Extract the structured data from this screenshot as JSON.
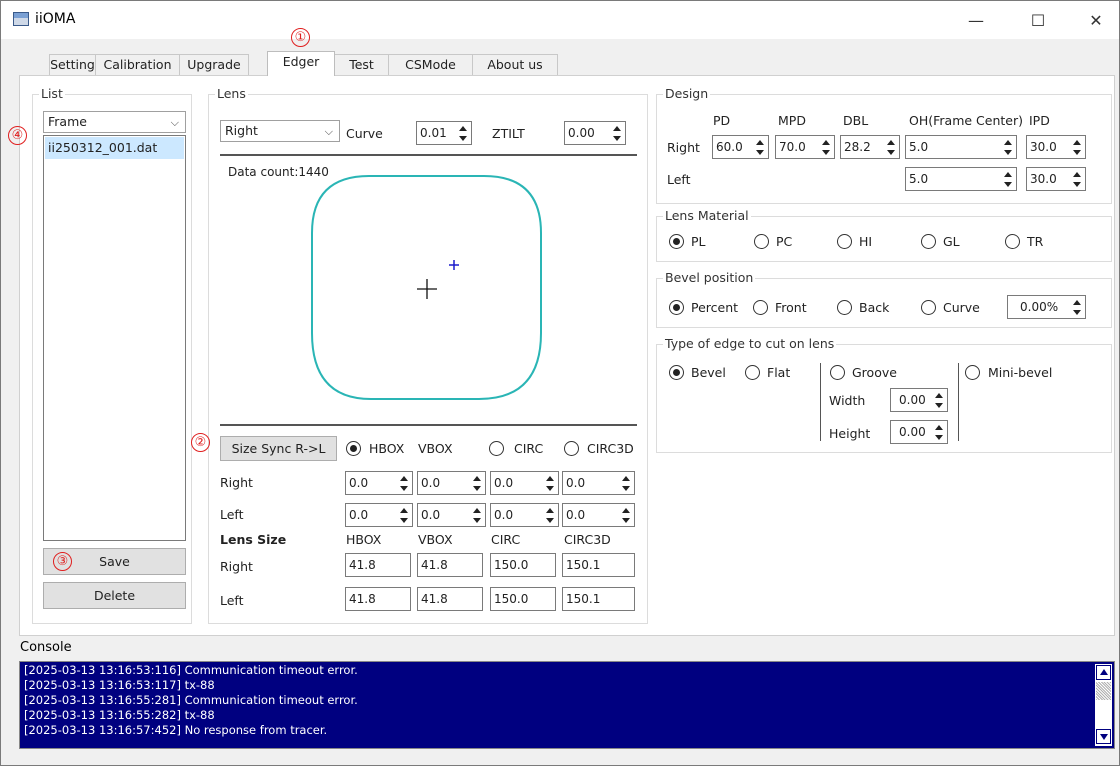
{
  "window": {
    "title": "iiOMA",
    "minimize": "—",
    "maximize": "☐",
    "close": "✕"
  },
  "tabs": [
    "Setting",
    "Calibration",
    "Upgrade",
    "Edger",
    "Test",
    "CSMode",
    "About us"
  ],
  "active_tab": "Edger",
  "markers": {
    "m1": "①",
    "m2": "②",
    "m3": "③",
    "m4": "④"
  },
  "list": {
    "group_label": "List",
    "combo_value": "Frame",
    "items": [
      "ii250312_001.dat"
    ],
    "save": "Save",
    "delete": "Delete"
  },
  "lens": {
    "group_label": "Lens",
    "side": "Right",
    "curve_label": "Curve",
    "curve_value": "0.01",
    "ztilt_label": "ZTILT",
    "ztilt_value": "0.00",
    "data_count": "Data count:1440",
    "shape_color": "#2ab5b5",
    "marker_color": "#1a1acc",
    "size_sync_button": "Size Sync R->L",
    "modes": [
      "HBOX",
      "VBOX",
      "CIRC",
      "CIRC3D"
    ],
    "selected_mode": "HBOX",
    "right_label": "Right",
    "left_label": "Left",
    "right_values": [
      "0.0",
      "0.0",
      "0.0",
      "0.0"
    ],
    "left_values": [
      "0.0",
      "0.0",
      "0.0",
      "0.0"
    ],
    "lens_size_label": "Lens Size",
    "lens_size_headers": [
      "HBOX",
      "VBOX",
      "CIRC",
      "CIRC3D"
    ],
    "size_right": [
      "41.8",
      "41.8",
      "150.0",
      "150.1"
    ],
    "size_left": [
      "41.8",
      "41.8",
      "150.0",
      "150.1"
    ]
  },
  "design": {
    "group_label": "Design",
    "headers": [
      "PD",
      "MPD",
      "DBL",
      "OH(Frame Center)",
      "IPD"
    ],
    "right_label": "Right",
    "left_label": "Left",
    "right": {
      "pd": "60.0",
      "mpd": "70.0",
      "dbl": "28.2",
      "oh": "5.0",
      "ipd": "30.0"
    },
    "left": {
      "oh": "5.0",
      "ipd": "30.0"
    }
  },
  "lens_material": {
    "group_label": "Lens Material",
    "options": [
      "PL",
      "PC",
      "HI",
      "GL",
      "TR"
    ],
    "selected": "PL"
  },
  "bevel_position": {
    "group_label": "Bevel position",
    "options": [
      "Percent",
      "Front",
      "Back",
      "Curve"
    ],
    "selected": "Percent",
    "value": "0.00%"
  },
  "edge_type": {
    "group_label": "Type of edge to cut on lens",
    "bevel": "Bevel",
    "flat": "Flat",
    "groove": "Groove",
    "mini_bevel": "Mini-bevel",
    "selected": "Bevel",
    "width_label": "Width",
    "width_value": "0.00",
    "height_label": "Height",
    "height_value": "0.00"
  },
  "console": {
    "label": "Console",
    "lines": [
      "[2025-03-13 13:16:53:116] Communication timeout error.",
      "[2025-03-13 13:16:53:117] tx-88",
      "[2025-03-13 13:16:55:281] Communication timeout error.",
      "[2025-03-13 13:16:55:282] tx-88",
      "[2025-03-13 13:16:57:452] No response from tracer."
    ]
  }
}
